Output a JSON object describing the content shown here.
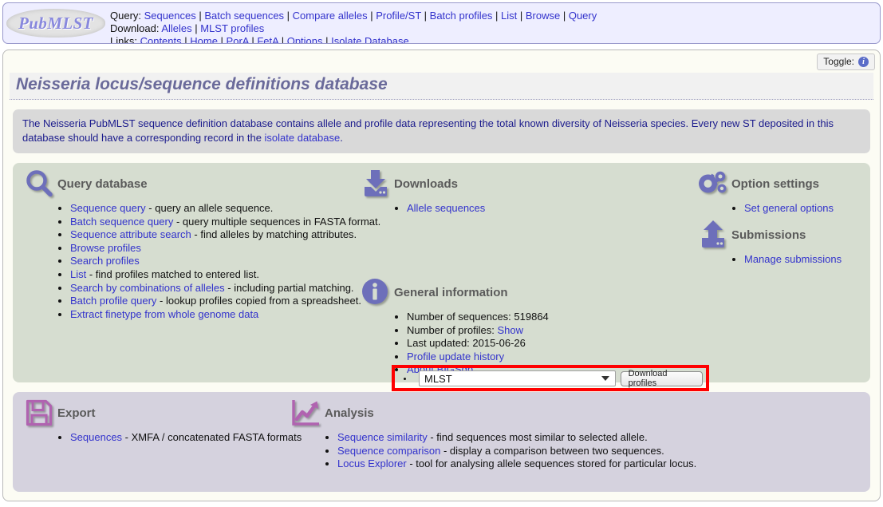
{
  "header": {
    "logo_text": "PubMLST",
    "rows": [
      {
        "label": "Query:",
        "links": [
          "Sequences",
          "Batch sequences",
          "Compare alleles",
          "Profile/ST",
          "Batch profiles",
          "List",
          "Browse",
          "Query"
        ]
      },
      {
        "label": "Download:",
        "links": [
          "Alleles",
          "MLST profiles"
        ]
      },
      {
        "label": "Links:",
        "links": [
          "Contents",
          "Home",
          "PorA",
          "FetA",
          "Options",
          "Isolate Database"
        ]
      }
    ]
  },
  "toggle": {
    "label": "Toggle:",
    "icon": "info-icon",
    "glyph": "i"
  },
  "page_title": "Neisseria locus/sequence definitions database",
  "blurb": {
    "text_before": "The Neisseria PubMLST sequence definition database contains allele and profile data representing the total known diversity of Neisseria species. Every new ST deposited in this database should have a corresponding record in the ",
    "link": "isolate database",
    "text_after": "."
  },
  "query_database": {
    "title": "Query database",
    "icon": "magnifier-icon",
    "items": [
      {
        "link": "Sequence query",
        "desc": " - query an allele sequence."
      },
      {
        "link": "Batch sequence query",
        "desc": " - query multiple sequences in FASTA format."
      },
      {
        "link": "Sequence attribute search",
        "desc": " - find alleles by matching attributes."
      },
      {
        "link": "Browse profiles",
        "desc": ""
      },
      {
        "link": "Search profiles",
        "desc": ""
      },
      {
        "link": "List",
        "desc": " - find profiles matched to entered list."
      },
      {
        "link": "Search by combinations of alleles",
        "desc": " - including partial matching."
      },
      {
        "link": "Batch profile query",
        "desc": " - lookup profiles copied from a spreadsheet."
      },
      {
        "link": "Extract finetype from whole genome data",
        "desc": ""
      }
    ]
  },
  "downloads": {
    "title": "Downloads",
    "icon": "download-icon",
    "items": [
      {
        "link": "Allele sequences",
        "desc": ""
      }
    ],
    "scheme_select": {
      "value": "MLST",
      "options": [
        "MLST"
      ],
      "caret": "chevron-down-icon"
    },
    "download_button": "Download profiles",
    "highlight_color": "#ff0000"
  },
  "general_information": {
    "title": "General information",
    "icon": "info-circle-icon",
    "items": [
      {
        "text": "Number of sequences: 519864",
        "link": "",
        "desc": ""
      },
      {
        "text": "Number of profiles: ",
        "link": "Show",
        "desc": ""
      },
      {
        "text": "Last updated: 2015-06-26",
        "link": "",
        "desc": ""
      },
      {
        "text": "",
        "link": "Profile update history",
        "desc": ""
      },
      {
        "text": "",
        "link": "About BIGSdb",
        "desc": ""
      }
    ]
  },
  "option_settings": {
    "title": "Option settings",
    "icon": "gears-icon",
    "items": [
      {
        "link": "Set general options",
        "desc": ""
      }
    ]
  },
  "submissions": {
    "title": "Submissions",
    "icon": "upload-icon",
    "items": [
      {
        "link": "Manage submissions",
        "desc": ""
      }
    ]
  },
  "export": {
    "title": "Export",
    "icon": "floppy-disk-icon",
    "items": [
      {
        "link": "Sequences",
        "desc": " - XMFA / concatenated FASTA formats"
      }
    ]
  },
  "analysis": {
    "title": "Analysis",
    "icon": "chart-trend-icon",
    "items": [
      {
        "link": "Sequence similarity",
        "desc": " - find sequences most similar to selected allele."
      },
      {
        "link": "Sequence comparison",
        "desc": " - display a comparison between two sequences."
      },
      {
        "link": "Locus Explorer",
        "desc": " - tool for analysing allele sequences stored for particular locus."
      }
    ]
  },
  "colors": {
    "link": "#3333cc",
    "title_purple": "#6a6a9a",
    "panel_green": "#d6ddd0",
    "panel_purple": "#d5d2de",
    "icon_blue": "#6d6fba",
    "icon_magenta": "#b063b0",
    "highlight_red": "#ff0000"
  }
}
